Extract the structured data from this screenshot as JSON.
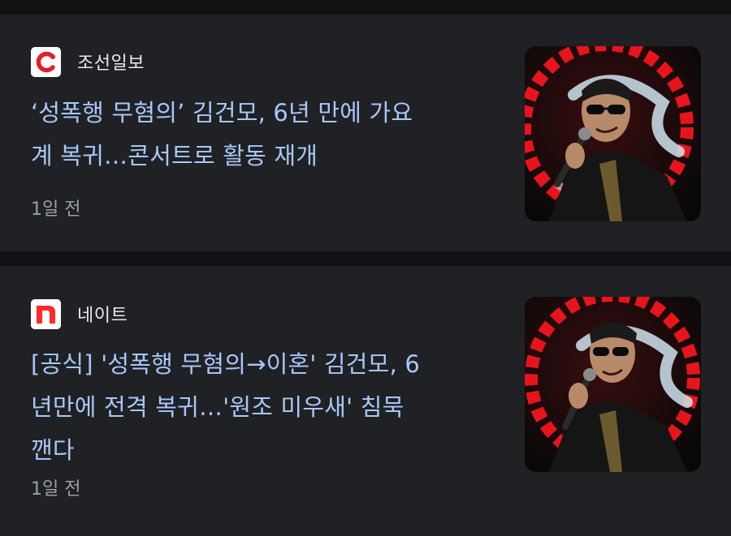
{
  "articles": [
    {
      "source": {
        "name": "조선일보",
        "logo_icon": "chosun-c-logo-icon",
        "logo_color": "#e0202e"
      },
      "headline_lines": [
        "‘성폭행 무혐의’ 김건모, 6년 만에 가요",
        "계 복귀…콘서트로 활동 재개"
      ],
      "time": "1일 전",
      "thumbnail_icon": "singer-concert-photo"
    },
    {
      "source": {
        "name": "네이트",
        "logo_icon": "nate-n-logo-icon",
        "logo_color": "#ff2a2a"
      },
      "headline_lines": [
        "[공식] '성폭행 무혐의→이혼' 김건모, 6",
        "년만에 전격 복귀…'원조 미우새' 침묵",
        "깬다"
      ],
      "time": "1일 전",
      "thumbnail_icon": "singer-concert-photo"
    }
  ],
  "colors": {
    "background": "#111114",
    "card": "#202124",
    "headline": "#a8c7fa",
    "source_text": "#e8eaed",
    "time_text": "#9aa0a6"
  }
}
